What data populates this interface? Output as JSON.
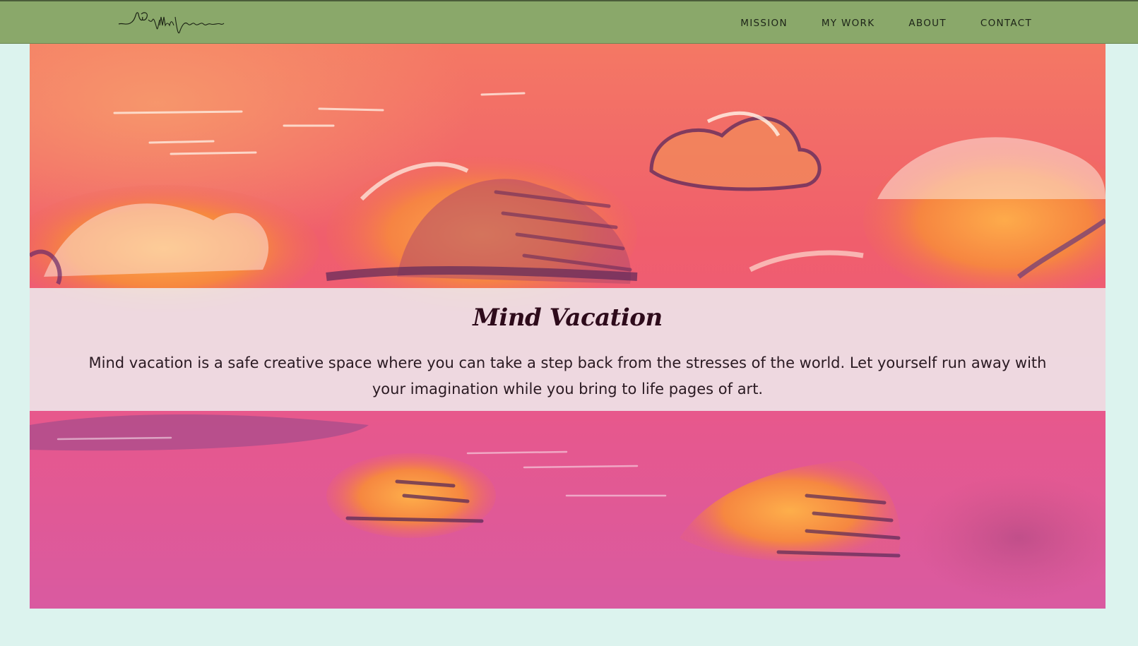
{
  "brand": {
    "logo_text": "Mind Vacation",
    "logo_icon": "signature-logo"
  },
  "nav": {
    "items": [
      {
        "label": "MISSION"
      },
      {
        "label": "MY WORK"
      },
      {
        "label": "ABOUT"
      },
      {
        "label": "CONTACT"
      }
    ]
  },
  "hero": {
    "image": "pink-cloud-painting",
    "title": "Mind Vacation",
    "description": "Mind vacation is a safe creative space where you can take a step back from the stresses of the world. Let yourself run away with your imagination while you bring to life pages of art."
  },
  "colors": {
    "page_background": "#dcf3ee",
    "navbar": "#8aa86a",
    "title_text": "#2e0b1b"
  }
}
